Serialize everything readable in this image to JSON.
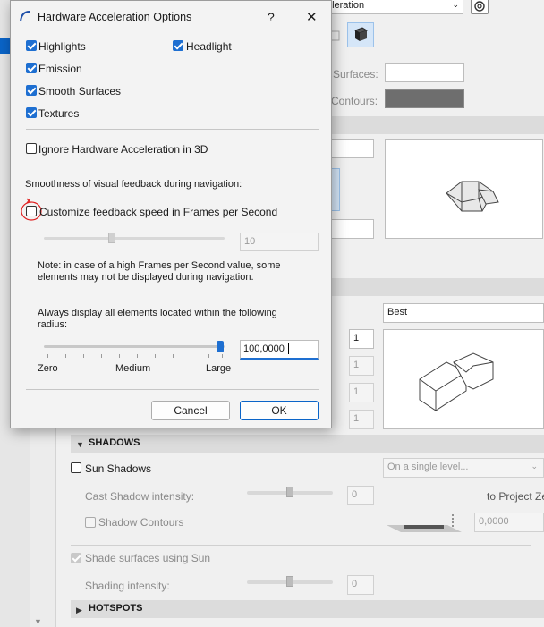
{
  "background": {
    "top_dropdown": "re acceleration",
    "surfaces_label": "Surfaces:",
    "contours_label": "Contours:",
    "contours_color": "#6e6e6e",
    "detail_select": "Best",
    "val1": "1",
    "val2": "1",
    "val3": "1",
    "val4": "1",
    "shadows_section": "SHADOWS",
    "sun_shadows": "Sun Shadows",
    "level_select": "On a single level...",
    "cast_shadow_label": "Cast Shadow intensity:",
    "cast_shadow_value": "0",
    "to_project_label": "to Project Ze",
    "shadow_contours": "Shadow Contours",
    "shadow_offset_value": "0,0000",
    "shade_surfaces": "Shade surfaces using Sun",
    "shading_intensity_label": "Shading intensity:",
    "shading_intensity_value": "0",
    "hotspots_section": "HOTSPOTS"
  },
  "dialog": {
    "title": "Hardware Acceleration Options",
    "help": "?",
    "close": "✕",
    "options": {
      "highlights": "Highlights",
      "headlight": "Headlight",
      "emission": "Emission",
      "smooth_surfaces": "Smooth Surfaces",
      "textures": "Textures",
      "ignore_hw": "Ignore Hardware Acceleration in 3D"
    },
    "smoothness_heading": "Smoothness of visual feedback during navigation:",
    "customize_fps": "Customize feedback speed in Frames per Second",
    "fps_value": "10",
    "note_line1": "Note: in case of a high Frames per Second value, some",
    "note_line2": "elements may not be displayed during navigation.",
    "radius_line1": "Always display all elements located within the following",
    "radius_line2": "radius:",
    "radius_value": "100,0000",
    "scale_zero": "Zero",
    "scale_medium": "Medium",
    "scale_large": "Large",
    "cancel": "Cancel",
    "ok": "OK"
  },
  "colors": {
    "accent": "#1e6fd1",
    "annotation": "#e02020"
  }
}
